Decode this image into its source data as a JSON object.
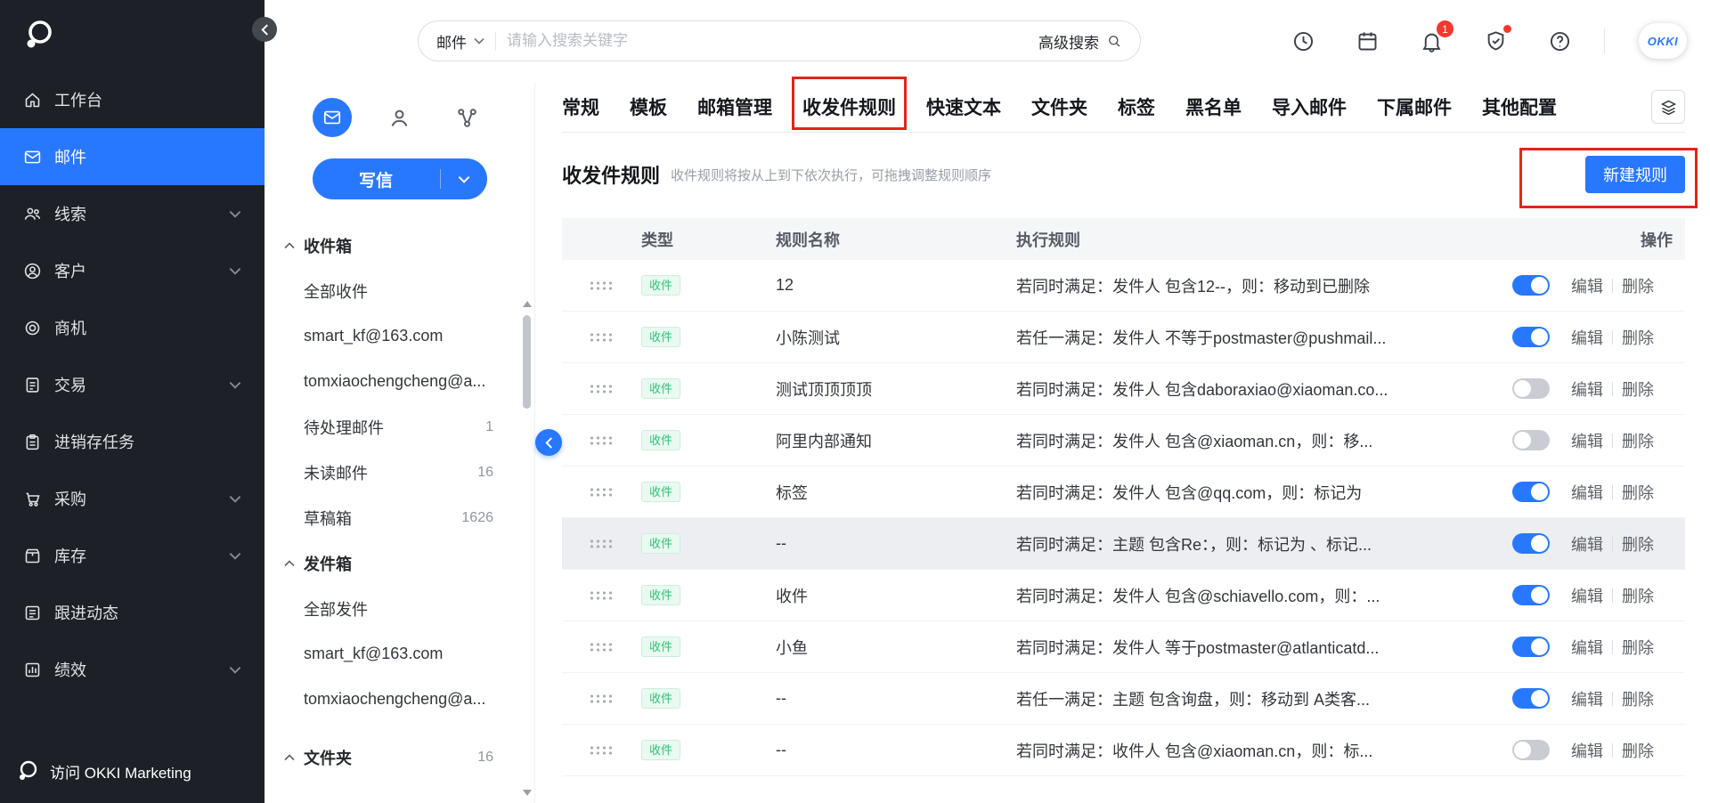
{
  "colors": {
    "accent_blue": "#2878ff",
    "badge_green": "#32c278",
    "annotation_red": "#e1251b",
    "toggle_off": "#c9ccd2",
    "nav_dark": "#1d2127"
  },
  "nav_sidebar": {
    "items": [
      {
        "label": "工作台"
      },
      {
        "label": "邮件",
        "active": true
      },
      {
        "label": "线索",
        "expandable": true
      },
      {
        "label": "客户",
        "expandable": true
      },
      {
        "label": "商机"
      },
      {
        "label": "交易",
        "expandable": true
      },
      {
        "label": "进销存任务"
      },
      {
        "label": "采购",
        "expandable": true
      },
      {
        "label": "库存",
        "expandable": true
      },
      {
        "label": "跟进动态"
      },
      {
        "label": "绩效",
        "expandable": true
      }
    ],
    "footer": {
      "label": "访问 OKKI Marketing"
    }
  },
  "header": {
    "search": {
      "scope": "邮件",
      "placeholder": "请输入搜索关键字",
      "advanced_label": "高级搜索"
    },
    "notification_count": "1",
    "brand_badge": "OKKI"
  },
  "mail_sidebar": {
    "compose_label": "写信",
    "items": [
      {
        "label": "收件箱",
        "type": "group"
      },
      {
        "label": "全部收件",
        "type": "child"
      },
      {
        "label": "smart_kf@163.com",
        "type": "child"
      },
      {
        "label": "tomxiaochengcheng@a...",
        "type": "child"
      },
      {
        "label": "待处理邮件",
        "count": "1"
      },
      {
        "label": "未读邮件",
        "count": "16"
      },
      {
        "label": "草稿箱",
        "count": "1626"
      },
      {
        "label": "发件箱",
        "type": "group"
      },
      {
        "label": "全部发件",
        "type": "child"
      },
      {
        "label": "smart_kf@163.com",
        "type": "child"
      },
      {
        "label": "tomxiaochengcheng@a...",
        "type": "child"
      },
      {
        "label": "文件夹",
        "type": "group",
        "count": "16"
      }
    ]
  },
  "tabs": [
    {
      "label": "常规"
    },
    {
      "label": "模板"
    },
    {
      "label": "邮箱管理"
    },
    {
      "label": "收发件规则",
      "annotated": true
    },
    {
      "label": "快速文本"
    },
    {
      "label": "文件夹"
    },
    {
      "label": "标签"
    },
    {
      "label": "黑名单"
    },
    {
      "label": "导入邮件"
    },
    {
      "label": "下属邮件"
    },
    {
      "label": "其他配置"
    }
  ],
  "content": {
    "title": "收发件规则",
    "subtitle": "收件规则将按从上到下依次执行，可拖拽调整规则顺序",
    "new_rule_label": "新建规则"
  },
  "table": {
    "columns": [
      "类型",
      "规则名称",
      "执行规则",
      "操作"
    ],
    "edit_label": "编辑",
    "delete_label": "删除",
    "rows": [
      {
        "type": "收件",
        "name": "12",
        "rule": "若同时满足：发件人 包含12--，则：移动到已删除",
        "enabled": true
      },
      {
        "type": "收件",
        "name": "小陈测试",
        "rule": "若任一满足：发件人 不等于postmaster@pushmail...",
        "enabled": true
      },
      {
        "type": "收件",
        "name": "测试顶顶顶顶",
        "rule": "若同时满足：发件人 包含daboraxiao@xiaoman.co...",
        "enabled": false
      },
      {
        "type": "收件",
        "name": "阿里内部通知",
        "rule": "若同时满足：发件人 包含@xiaoman.cn，则：移...",
        "enabled": false
      },
      {
        "type": "收件",
        "name": "标签",
        "rule": "若同时满足：发件人 包含@qq.com，则：标记为",
        "enabled": true
      },
      {
        "type": "收件",
        "name": "--",
        "rule": "若同时满足：主题 包含Re：，则：标记为 、标记...",
        "enabled": true,
        "highlighted": true
      },
      {
        "type": "收件",
        "name": "收件",
        "rule": "若同时满足：发件人 包含@schiavello.com，则：...",
        "enabled": true
      },
      {
        "type": "收件",
        "name": "小鱼",
        "rule": "若同时满足：发件人 等于postmaster@atlanticatd...",
        "enabled": true
      },
      {
        "type": "收件",
        "name": "--",
        "rule": "若任一满足：主题 包含询盘，则：移动到 A类客...",
        "enabled": true
      },
      {
        "type": "收件",
        "name": "--",
        "rule": "若同时满足：收件人 包含@xiaoman.cn，则：标...",
        "enabled": false
      }
    ]
  }
}
